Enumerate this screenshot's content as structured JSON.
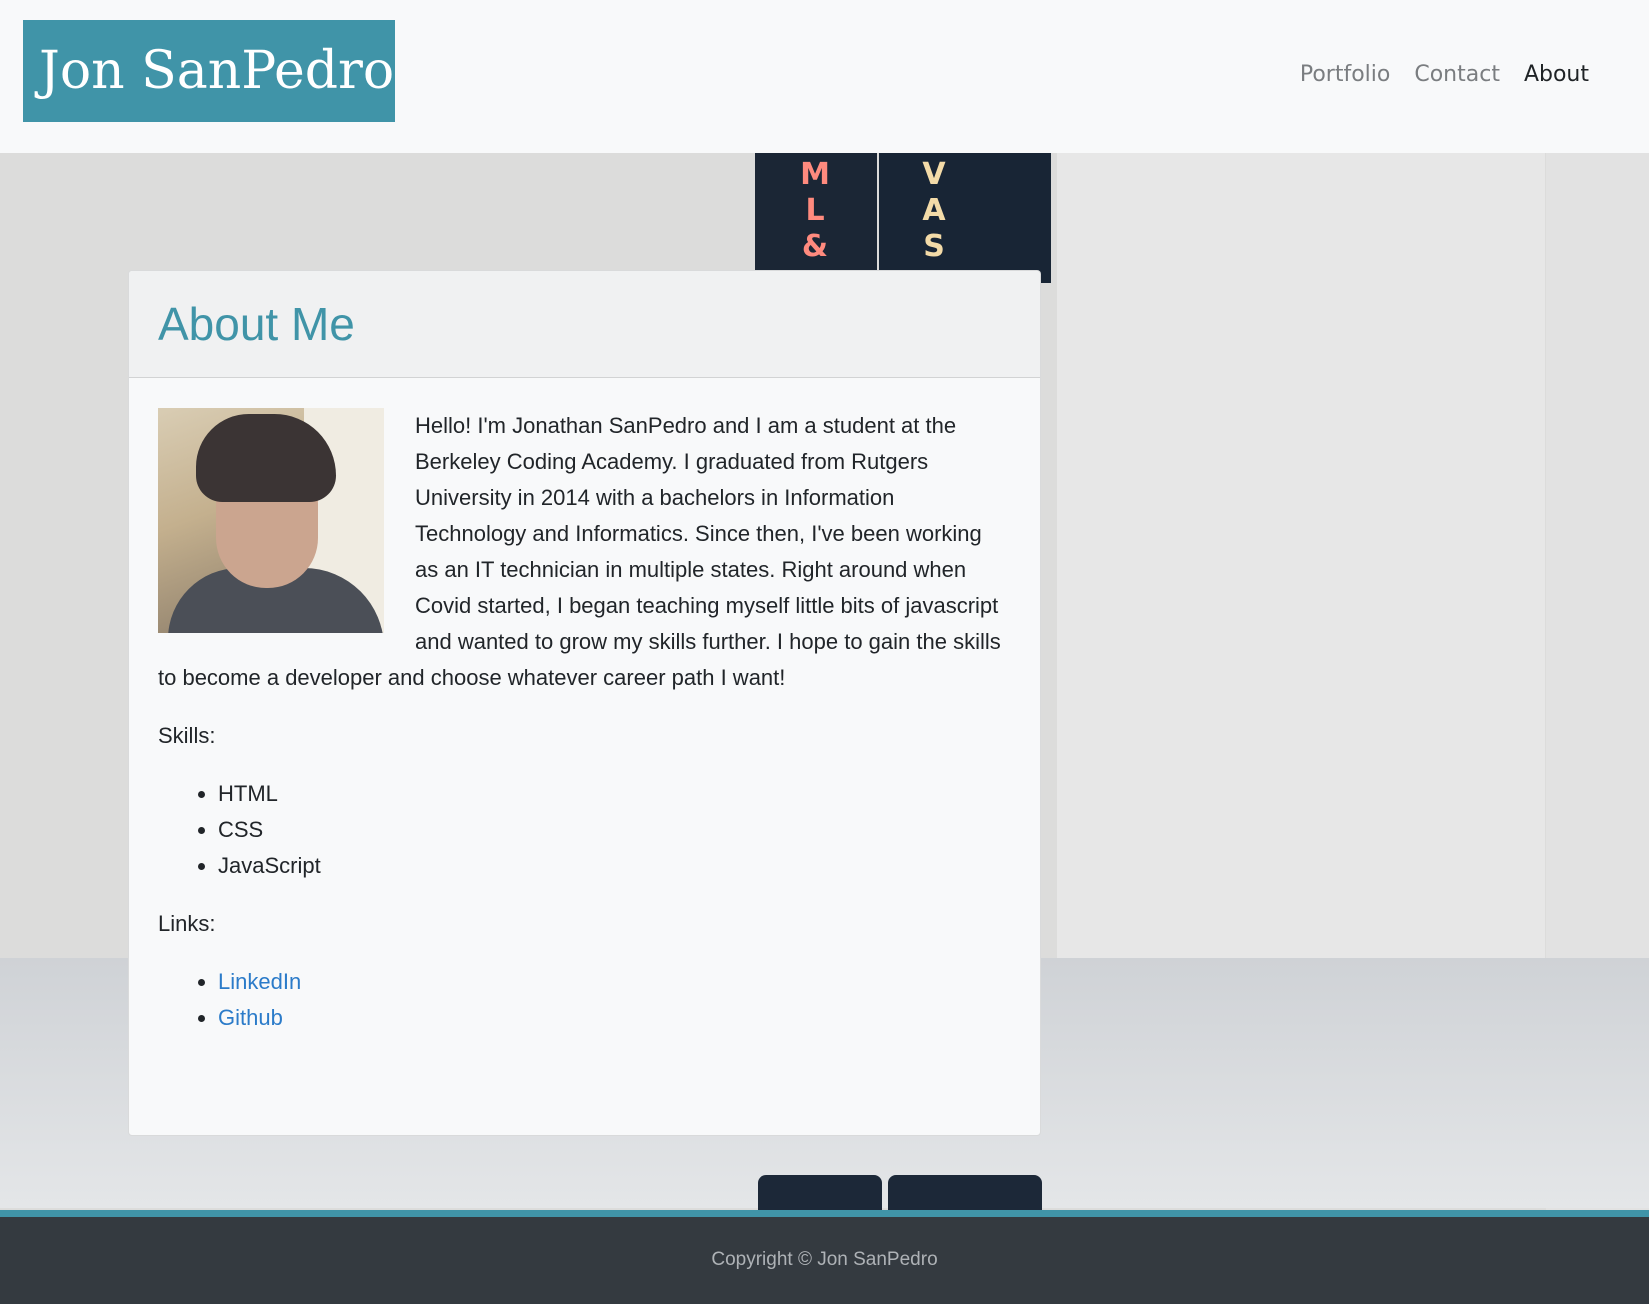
{
  "navbar": {
    "brand": "Jon SanPedro",
    "links": [
      {
        "label": "Portfolio",
        "active": false
      },
      {
        "label": "Contact",
        "active": false
      },
      {
        "label": "About",
        "active": true
      }
    ]
  },
  "background": {
    "spine_left": [
      "M",
      "L",
      "&"
    ],
    "spine_right": [
      "V",
      "A",
      "S"
    ]
  },
  "about": {
    "title": "About Me",
    "bio": "Hello! I'm Jonathan SanPedro and I am a student at the Berkeley Coding Academy. I graduated from Rutgers University in 2014 with a bachelors in Information Technology and Informatics. Since then, I've been working as an IT technician in multiple states. Right around when Covid started, I began teaching myself little bits of javascript and wanted to grow my skills further. I hope to gain the skills to become a developer and choose whatever career path I want!",
    "skills_label": "Skills:",
    "skills": [
      "HTML",
      "CSS",
      "JavaScript"
    ],
    "links_label": "Links:",
    "links": [
      "LinkedIn",
      "Github"
    ]
  },
  "footer": {
    "text": "Copyright © Jon SanPedro"
  },
  "colors": {
    "accent": "#4094a8",
    "link": "#2b7bc9",
    "footer_bg": "#343a40"
  }
}
